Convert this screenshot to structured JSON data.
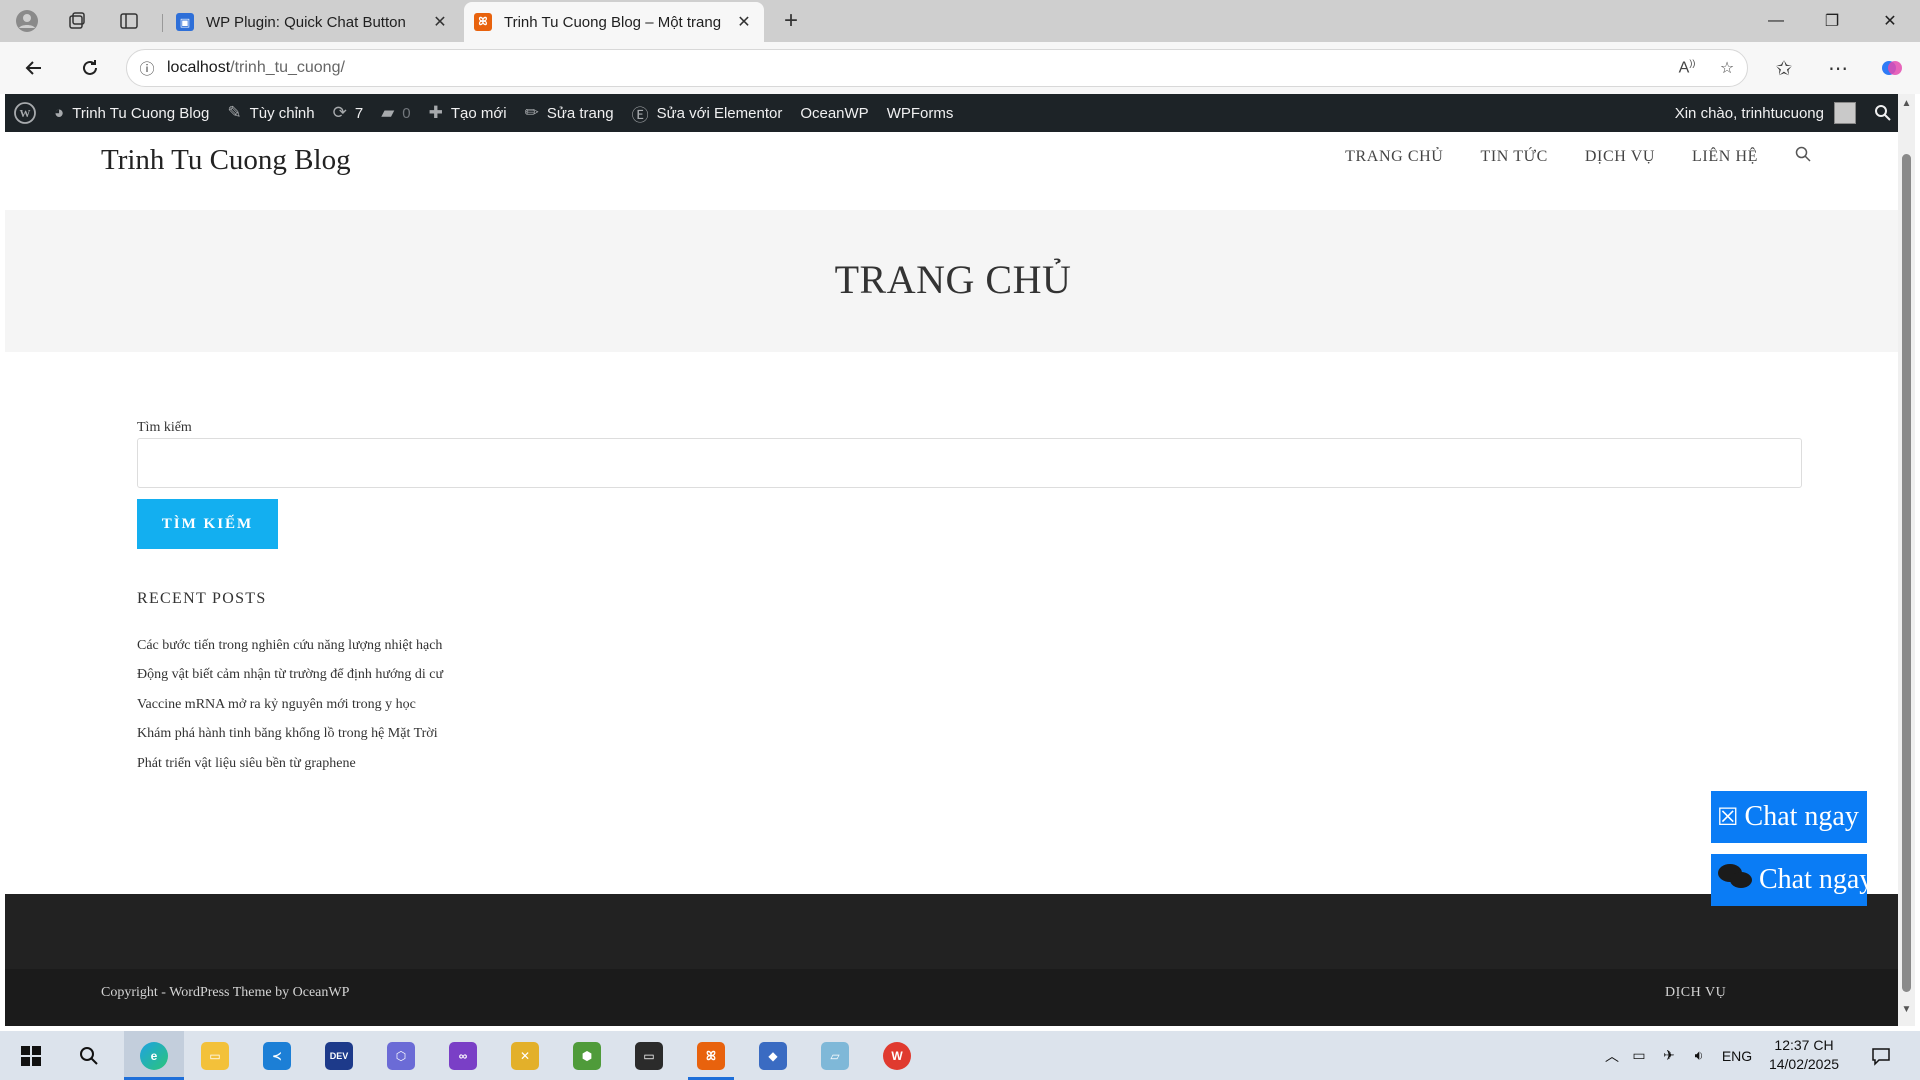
{
  "browser": {
    "tabs": [
      {
        "title": "WP Plugin: Quick Chat Button",
        "active": false
      },
      {
        "title": "Trinh Tu Cuong Blog – Một trang",
        "active": true
      }
    ],
    "address": {
      "host": "localhost",
      "path": "/trinh_tu_cuong/"
    }
  },
  "admin_bar": {
    "site_name": "Trinh Tu Cuong Blog",
    "customize": "Tùy chỉnh",
    "updates_count": "7",
    "comments_count": "0",
    "new": "Tạo mới",
    "edit_page": "Sửa trang",
    "edit_elementor": "Sửa với Elementor",
    "oceanwp": "OceanWP",
    "wpforms": "WPForms",
    "greeting": "Xin chào, trinhtucuong"
  },
  "site": {
    "title": "Trinh Tu Cuong Blog",
    "nav": [
      "TRANG CHỦ",
      "TIN TỨC",
      "DỊCH VỤ",
      "LIÊN HỆ"
    ]
  },
  "page": {
    "title": "TRANG CHỦ",
    "search_label": "Tìm kiếm",
    "search_value": "",
    "search_button": "TÌM KIẾM",
    "recent_posts_title": "RECENT POSTS",
    "recent_posts": [
      "Các bước tiến trong nghiên cứu năng lượng nhiệt hạch",
      "Động vật biết cảm nhận từ trường để định hướng di cư",
      "Vaccine mRNA mở ra kỷ nguyên mới trong y học",
      "Khám phá hành tinh băng khổng lồ trong hệ Mặt Trời",
      "Phát triển vật liệu siêu bền từ graphene"
    ]
  },
  "footer": {
    "copyright": "Copyright - WordPress Theme by OceanWP",
    "nav_partial": "DỊCH VỤ"
  },
  "chat_buttons": [
    {
      "label": "Chat ngay",
      "icon": "close-box-icon"
    },
    {
      "label": "Chat ngay",
      "icon": "comments-icon"
    }
  ],
  "taskbar": {
    "language": "ENG",
    "time": "12:37 CH",
    "date": "14/02/2025"
  },
  "colors": {
    "admin_bar": "#1d2327",
    "accent_button": "#13aff0",
    "chat_button": "#0a7cf5",
    "footer": "#222222"
  }
}
